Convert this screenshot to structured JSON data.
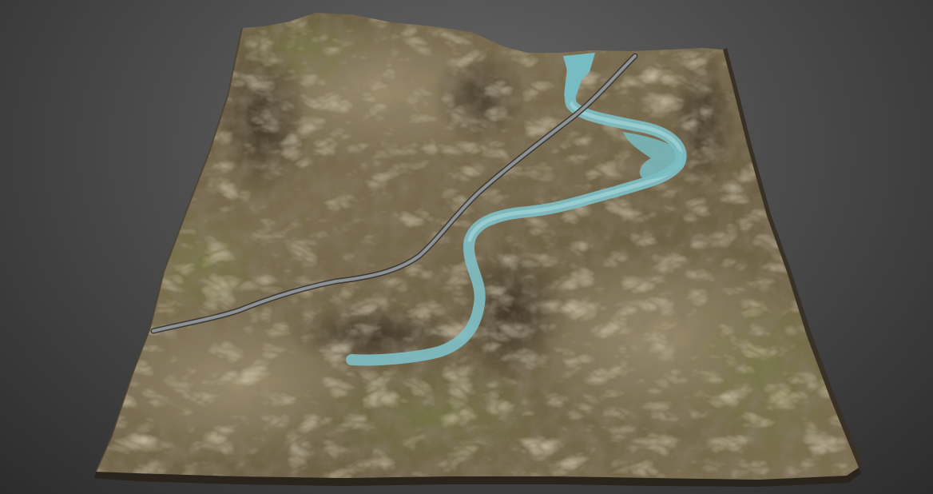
{
  "scene": {
    "subject": "terrain",
    "colors": {
      "background_center": "#6a6a6a",
      "background_edge": "#2c2c2c",
      "terrain_light": "#8a7c5e",
      "terrain_mid": "#6b5e45",
      "terrain_dark": "#3e3427",
      "grass": "#6f7140",
      "water": "#6fb6bd",
      "water_edge": "#a9dbe0",
      "road": "#8c9296",
      "cliff_side": "#2a241c"
    }
  }
}
